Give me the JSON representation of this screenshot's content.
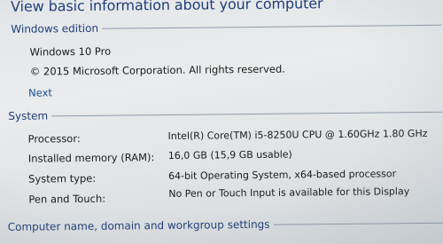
{
  "page": {
    "title": "View basic information about your computer"
  },
  "windows_edition": {
    "header": "Windows edition",
    "edition": "Windows 10 Pro",
    "copyright": "© 2015 Microsoft Corporation. All rights reserved.",
    "next_link": "Next"
  },
  "system": {
    "header": "System",
    "rows": [
      {
        "label": "Processor:",
        "value": "Intel(R) Core(TM) i5-8250U CPU @ 1.60GHz   1.80 GHz"
      },
      {
        "label": "Installed memory (RAM):",
        "value": "16,0 GB (15,9 GB usable)"
      },
      {
        "label": "System type:",
        "value": "64-bit Operating System, x64-based processor"
      },
      {
        "label": "Pen and Touch:",
        "value": "No Pen or Touch Input is available for this Display"
      }
    ]
  },
  "computer_name": {
    "header": "Computer name, domain and workgroup settings"
  },
  "colors": {
    "heading": "#1e3d78",
    "link": "#1d4f96",
    "text": "#1a1a1a",
    "rule": "#8e9aa6"
  }
}
